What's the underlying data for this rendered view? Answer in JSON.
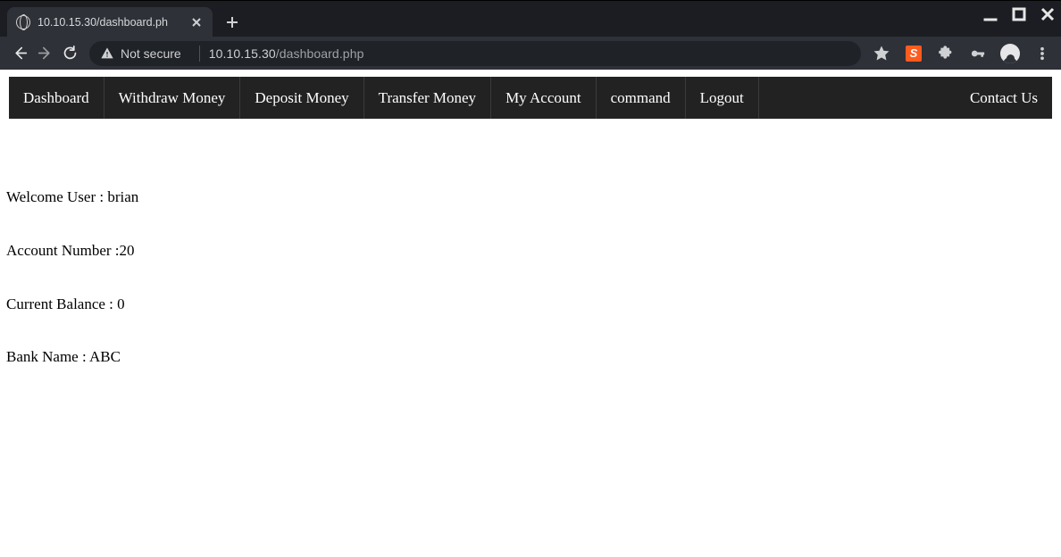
{
  "browser": {
    "tab_title": "10.10.15.30/dashboard.ph",
    "not_secure_label": "Not secure",
    "url_host": "10.10.15.30",
    "url_path": "/dashboard.php"
  },
  "navbar": {
    "items": [
      {
        "label": "Dashboard"
      },
      {
        "label": "Withdraw Money"
      },
      {
        "label": "Deposit Money"
      },
      {
        "label": "Transfer Money"
      },
      {
        "label": "My Account"
      },
      {
        "label": "command"
      },
      {
        "label": "Logout"
      }
    ],
    "right_label": "Contact Us"
  },
  "dashboard": {
    "welcome_label": "Welcome User : brian",
    "account_label": "Account Number :20",
    "balance_label": "Current Balance : 0",
    "bank_label": "Bank Name : ABC"
  }
}
